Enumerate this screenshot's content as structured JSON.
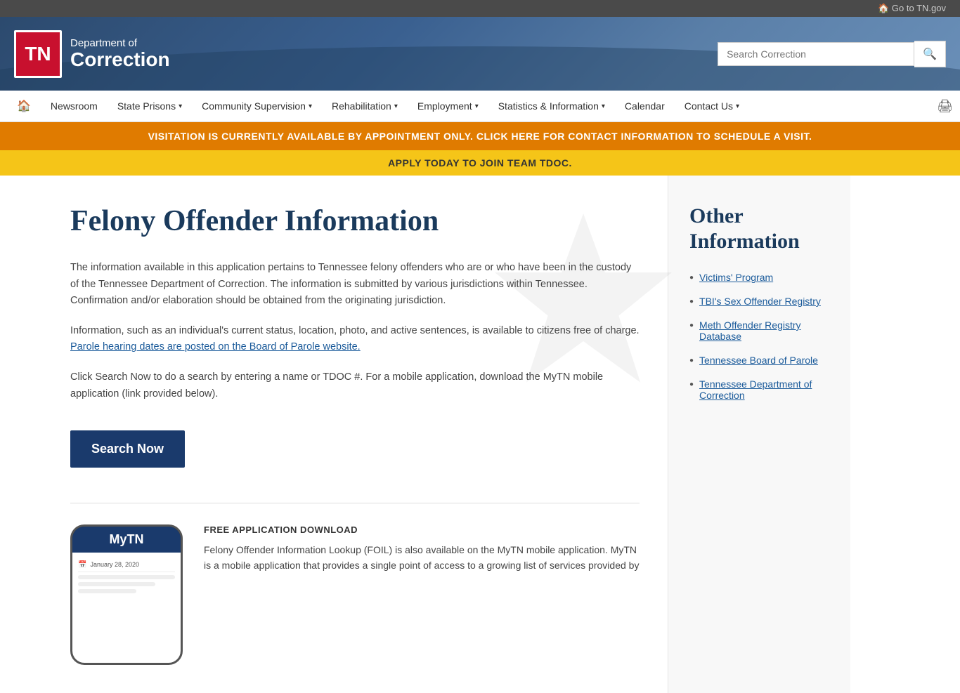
{
  "topBar": {
    "homeLink": "🏠 Go to TN.gov"
  },
  "header": {
    "logoText": "TN",
    "deptOf": "Department of",
    "correction": "Correction",
    "searchPlaceholder": "Search Correction"
  },
  "nav": {
    "home": "🏠",
    "items": [
      {
        "id": "newsroom",
        "label": "Newsroom",
        "hasDropdown": false
      },
      {
        "id": "state-prisons",
        "label": "State Prisons",
        "hasDropdown": true
      },
      {
        "id": "community-supervision",
        "label": "Community Supervision",
        "hasDropdown": true
      },
      {
        "id": "rehabilitation",
        "label": "Rehabilitation",
        "hasDropdown": true
      },
      {
        "id": "employment",
        "label": "Employment",
        "hasDropdown": true
      },
      {
        "id": "statistics",
        "label": "Statistics & Information",
        "hasDropdown": true
      },
      {
        "id": "calendar",
        "label": "Calendar",
        "hasDropdown": false
      },
      {
        "id": "contact-us",
        "label": "Contact Us",
        "hasDropdown": true
      }
    ],
    "print": "🖨"
  },
  "banners": {
    "orange": "VISITATION IS CURRENTLY AVAILABLE BY APPOINTMENT ONLY. CLICK HERE FOR CONTACT INFORMATION TO SCHEDULE A VISIT.",
    "yellow": "APPLY TODAY TO JOIN TEAM TDOC."
  },
  "mainContent": {
    "pageTitle": "Felony Offender Information",
    "paragraph1": "The information available in this application pertains to Tennessee felony offenders who are or who have been in the custody of the Tennessee Department of Correction.  The information is submitted by various jurisdictions within Tennessee.  Confirmation and/or elaboration should be obtained from the originating jurisdiction.",
    "paragraph2": "Information, such as an individual's current status, location, photo, and active sentences, is available to citizens free of charge.",
    "paroleLink": "Parole hearing dates are posted on the Board of Parole website.",
    "paragraph3": "Click Search Now to do a search by entering a name or TDOC #.  For a mobile application, download the MyTN mobile application (link provided below).",
    "searchNowLabel": "Search Now",
    "appSection": {
      "appTitle": "FREE APPLICATION DOWNLOAD",
      "phoneName": "MyTN",
      "phoneDate": "January 28, 2020",
      "appDescription": "Felony Offender Information Lookup (FOIL) is also available on the MyTN mobile application.  MyTN is a mobile application that provides a single point of access to a growing list of services provided by"
    }
  },
  "sidebar": {
    "title": "Other Information",
    "links": [
      {
        "id": "victims-program",
        "label": "Victims' Program"
      },
      {
        "id": "tbi-sex-offender",
        "label": "TBI's Sex Offender Registry"
      },
      {
        "id": "meth-offender",
        "label": "Meth Offender Registry Database"
      },
      {
        "id": "board-of-parole",
        "label": "Tennessee Board of Parole"
      },
      {
        "id": "tdoc",
        "label": "Tennessee Department of Correction"
      }
    ]
  }
}
